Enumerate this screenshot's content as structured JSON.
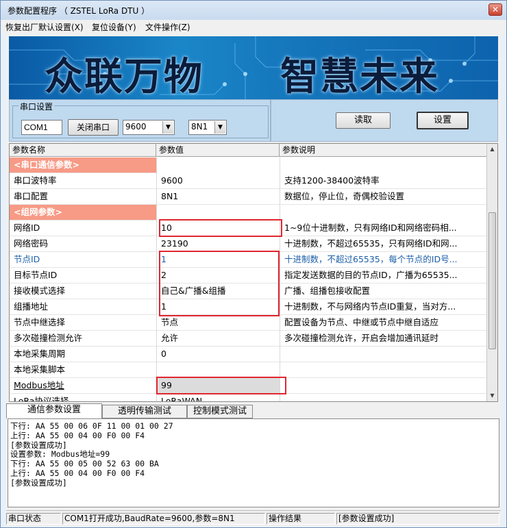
{
  "window": {
    "title": "参数配置程序  （ ZSTEL LoRa DTU ）"
  },
  "menu": [
    "恢复出厂默认设置(X)",
    "复位设备(Y)",
    "文件操作(Z)"
  ],
  "banner": {
    "left_text": "众联万物",
    "right_text": "智慧未来"
  },
  "serial": {
    "legend": "串口设置",
    "port": "COM1",
    "close_port_label": "关闭串口",
    "baud": "9600",
    "format": "8N1"
  },
  "actions": {
    "read_label": "读取",
    "set_label": "设置"
  },
  "grid": {
    "headers": [
      "参数名称",
      "参数值",
      "参数说明"
    ],
    "rows": [
      {
        "name": "<串口通信参数>",
        "value": "",
        "desc": ""
      },
      {
        "name": "串口波特率",
        "value": "9600",
        "desc": "支持1200-38400波特率"
      },
      {
        "name": "串口配置",
        "value": "8N1",
        "desc": "数据位，停止位，奇偶校验设置"
      },
      {
        "name": "<组网参数>",
        "value": "",
        "desc": ""
      },
      {
        "name": "网络ID",
        "value": "10",
        "desc": "1~9位十进制数，只有网络ID和网络密码相..."
      },
      {
        "name": "网络密码",
        "value": "23190",
        "desc": "十进制数，不超过65535，只有网络ID和网..."
      },
      {
        "name": "节点ID",
        "value": "1",
        "desc": "十进制数，不超过65535，每个节点的ID号..."
      },
      {
        "name": "目标节点ID",
        "value": "2",
        "desc": "指定发送数据的目的节点ID，广播为65535..."
      },
      {
        "name": "接收模式选择",
        "value": "自己&广播&组播",
        "desc": "广播、组播包接收配置"
      },
      {
        "name": "组播地址",
        "value": "1",
        "desc": "十进制数，不与网络内节点ID重复，当对方..."
      },
      {
        "name": "节点中继选择",
        "value": "节点",
        "desc": "配置设备为节点、中继或节点中继自适应"
      },
      {
        "name": "多次碰撞检测允许",
        "value": "允许",
        "desc": "多次碰撞检测允许，开启会增加通讯延时"
      },
      {
        "name": "本地采集周期",
        "value": "0",
        "desc": ""
      },
      {
        "name": "本地采集脚本",
        "value": "",
        "desc": ""
      },
      {
        "name": "Modbus地址",
        "value": "99",
        "desc": ""
      },
      {
        "name": "LoRa协议选择",
        "value": "LoRaWAN",
        "desc": ""
      }
    ]
  },
  "tabs": [
    "通信参数设置",
    "透明传输测试",
    "控制模式测试"
  ],
  "log": [
    "下行: AA 55 00 06 0F 11 00 01 00 27",
    "上行: AA 55 00 04 00 F0 00 F4",
    "[参数设置成功]",
    "设置参数: Modbus地址=99",
    "下行: AA 55 00 05 00 52 63 00 BA",
    "上行: AA 55 00 04 00 F0 00 F4",
    "[参数设置成功]"
  ],
  "status": {
    "port_label": "串口状态",
    "port_value": "COM1打开成功,BaudRate=9600,参数=8N1",
    "result_label": "操作结果",
    "result_value": "[参数设置成功]"
  },
  "colors": {
    "section_row": "#f79a86",
    "highlight_box": "#e0262f",
    "selected_text": "#1a5ea8"
  }
}
